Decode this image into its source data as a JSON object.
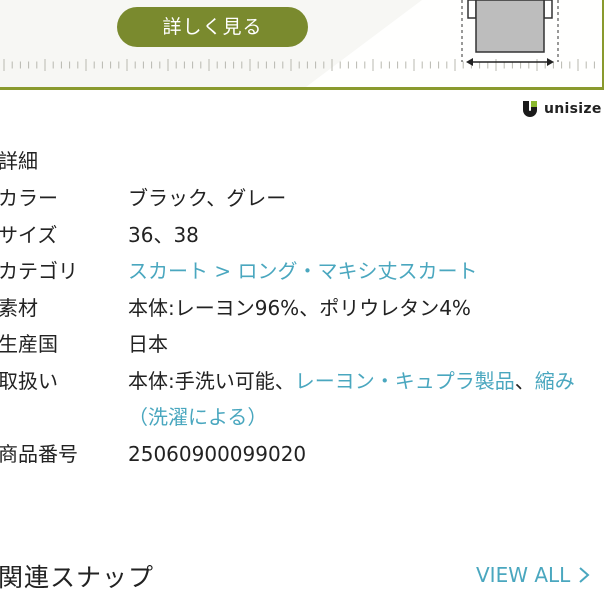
{
  "banner": {
    "button_label": "詳しく見る"
  },
  "brand": {
    "name": "unisize",
    "accent": "#8a9a2e"
  },
  "details": {
    "title": "詳細",
    "rows": [
      {
        "label": "カラー",
        "value": "ブラック、グレー"
      },
      {
        "label": "サイズ",
        "value": "36、38"
      },
      {
        "label": "カテゴリ",
        "link1": "スカート",
        "sep": " > ",
        "link2": "ロング・マキシ丈スカート"
      },
      {
        "label": "素材",
        "value": "本体:レーヨン96%、ポリウレタン4%"
      },
      {
        "label": "生産国",
        "value": "日本"
      },
      {
        "label": "取扱い",
        "prefix": "本体:手洗い可能、",
        "link1": "レーヨン・キュプラ製品",
        "sep": "、",
        "link2": "縮み",
        "line2": "（洗濯による）"
      },
      {
        "label": "商品番号",
        "value": "25060900099020"
      }
    ]
  },
  "related": {
    "title": "関連スナップ",
    "view_all": "VIEW ALL"
  },
  "colors": {
    "link": "#4aa7bf",
    "button": "#7a8a2e"
  }
}
